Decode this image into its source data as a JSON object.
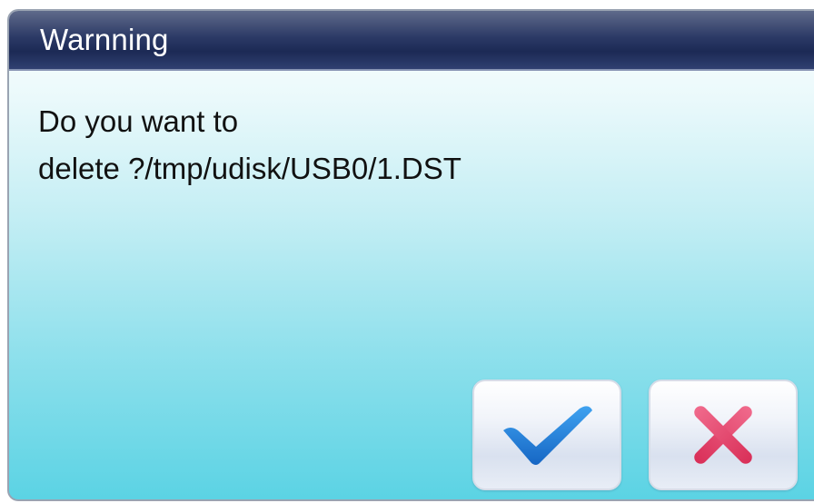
{
  "dialog": {
    "title": "Warnning",
    "message_lines": [
      "Do you want to",
      "delete ?/tmp/udisk/USB0/1.DST"
    ]
  },
  "buttons": {
    "confirm_icon": "checkmark-icon",
    "cancel_icon": "cross-icon"
  },
  "colors": {
    "title_bar": "#2c3a66",
    "checkmark": "#1e79d6",
    "cross": "#e8466c"
  }
}
